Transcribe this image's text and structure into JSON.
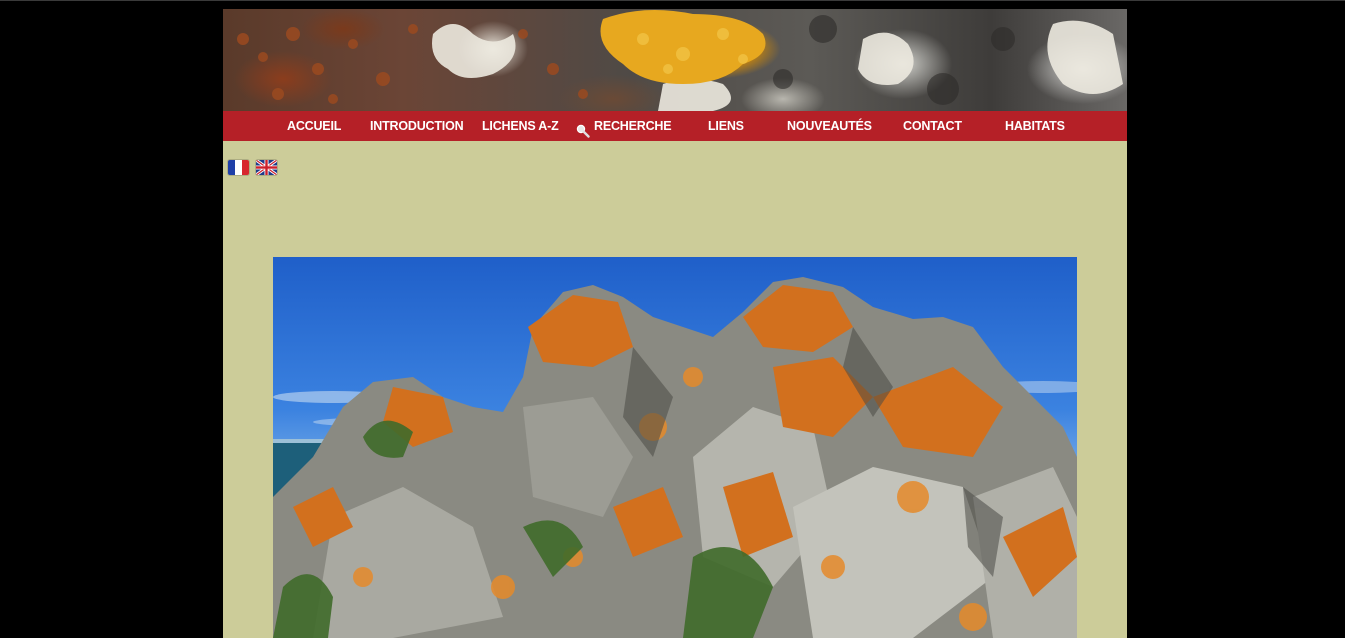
{
  "nav": {
    "items": [
      {
        "label": "ACCUEIL",
        "name": "nav-accueil"
      },
      {
        "label": "INTRODUCTION",
        "name": "nav-introduction"
      },
      {
        "label": "LICHENS A-Z",
        "name": "nav-lichens-a-z"
      },
      {
        "label": "RECHERCHE",
        "name": "nav-recherche",
        "icon": "magnifier-icon"
      },
      {
        "label": "LIENS",
        "name": "nav-liens"
      },
      {
        "label": "NOUVEAUTÉS",
        "name": "nav-nouveautes"
      },
      {
        "label": "CONTACT",
        "name": "nav-contact"
      },
      {
        "label": "HABITATS",
        "name": "nav-habitats"
      }
    ]
  },
  "languages": [
    {
      "code": "fr",
      "icon": "french-flag-icon"
    },
    {
      "code": "en",
      "icon": "uk-flag-icon"
    }
  ],
  "colors": {
    "nav_bg": "#b52027",
    "page_bg": "#cccc99",
    "body_bg": "#000000"
  },
  "images": {
    "banner": "lichen-banner-image",
    "main": "lichen-covered-rocks-photo"
  }
}
